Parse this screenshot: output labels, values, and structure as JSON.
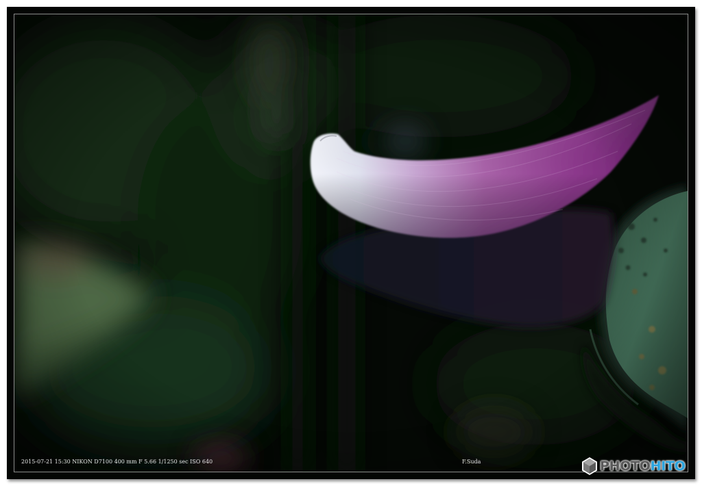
{
  "photo": {
    "subject": "lotus-petal-on-water"
  },
  "caption": {
    "exif": "2015-07-21 15:30 NIKON D7100 400 mm F 5.66 1/1250 sec ISO 640",
    "author": "F.Suda"
  },
  "watermark": {
    "text_part1": "PHOTO",
    "text_part2": "HITO",
    "colors": {
      "part1": "#5a5a5a",
      "part2": "#2aa3dd"
    }
  },
  "colors": {
    "frame": "#040604",
    "petal_pink": "#8a2f86",
    "petal_white": "#eef1f8",
    "lily_pad": "#3f6a52"
  }
}
